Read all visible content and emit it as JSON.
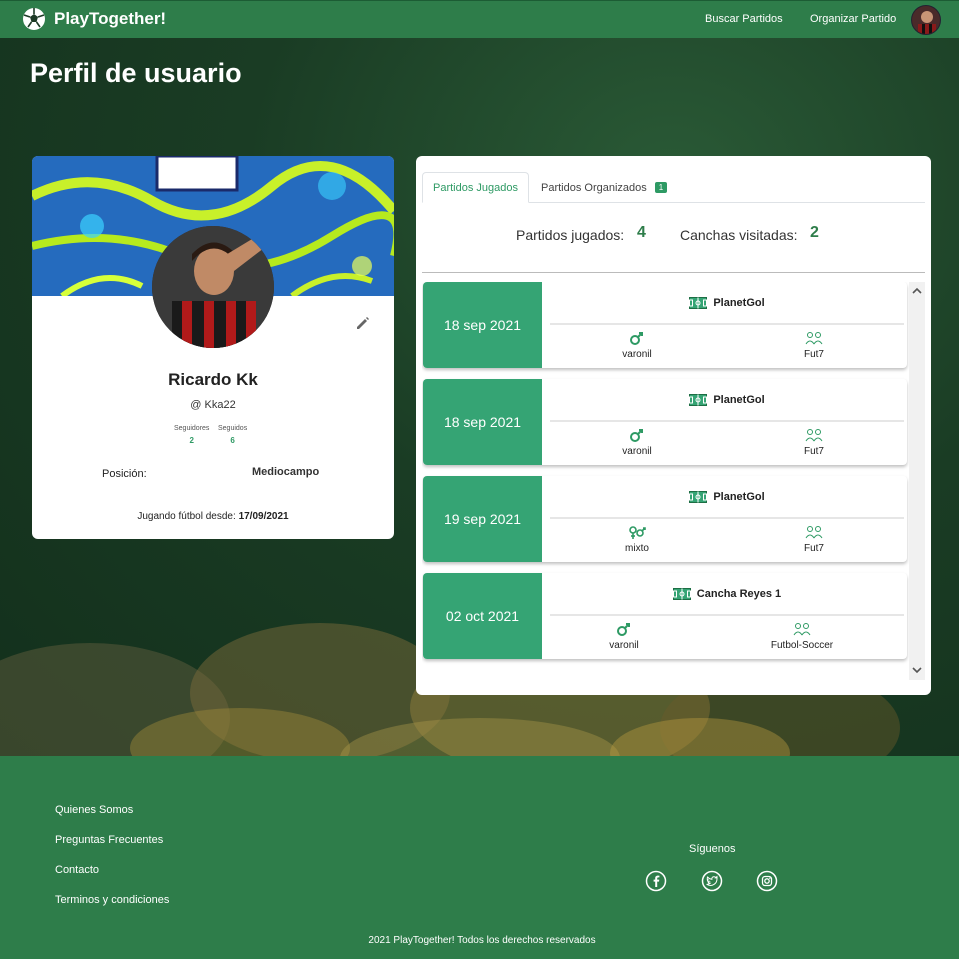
{
  "navbar": {
    "brand": "PlayTogether!",
    "links": [
      "Buscar Partidos",
      "Organizar Partido"
    ]
  },
  "page_title": "Perfil de usuario",
  "profile": {
    "name": "Ricardo Kk",
    "handle": "@ Kka22",
    "followers_label": "Seguidores",
    "followers": "2",
    "following_label": "Seguidos",
    "following": "6",
    "position_label": "Posición:",
    "position": "Mediocampo",
    "since_label": "Jugando fútbol desde:",
    "since_date": "17/09/2021"
  },
  "tabs": {
    "played": "Partidos Jugados",
    "organized": "Partidos Organizados",
    "organized_count": "1"
  },
  "summary": {
    "played_label": "Partidos jugados:",
    "played_value": "4",
    "venues_label": "Canchas visitadas:",
    "venues_value": "2"
  },
  "matches": [
    {
      "date": "18 sep 2021",
      "venue": "PlanetGol",
      "gender": "varonil",
      "format": "Fut7"
    },
    {
      "date": "18 sep 2021",
      "venue": "PlanetGol",
      "gender": "varonil",
      "format": "Fut7"
    },
    {
      "date": "19 sep 2021",
      "venue": "PlanetGol",
      "gender": "mixto",
      "format": "Fut7"
    },
    {
      "date": "02 oct 2021",
      "venue": "Cancha Reyes 1",
      "gender": "varonil",
      "format": "Futbol-Soccer"
    }
  ],
  "footer": {
    "links": [
      "Quienes Somos",
      "Preguntas Frecuentes",
      "Contacto",
      "Terminos y condiciones"
    ],
    "follow_label": "Síguenos",
    "social_icons": [
      "facebook-icon",
      "twitter-icon",
      "instagram-icon"
    ],
    "copyright": "2021 PlayTogether! Todos los derechos reservados"
  },
  "colors": {
    "primary": "#2e7d4a",
    "accent": "#35a474",
    "text_accent": "#2e9a64"
  }
}
